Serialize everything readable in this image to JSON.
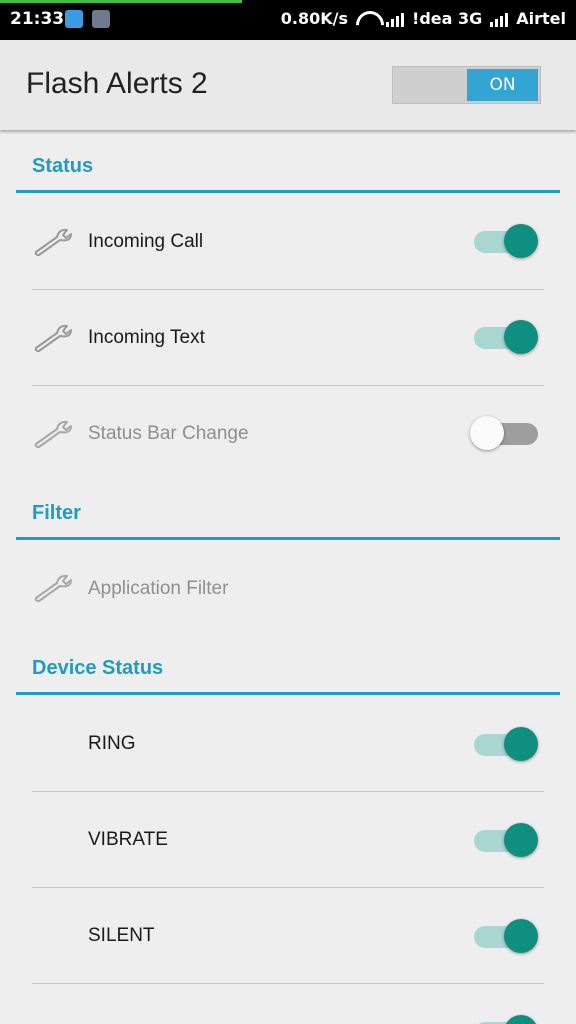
{
  "status_bar": {
    "time": "21:33",
    "net_speed": "0.80K/s",
    "carrier1": "!dea 3G",
    "carrier2": "Airtel"
  },
  "app_bar": {
    "title": "Flash Alerts 2",
    "master_toggle_label": "ON"
  },
  "sections": {
    "status": {
      "header": "Status",
      "items": [
        {
          "label": "Incoming Call",
          "enabled": true,
          "checked": true
        },
        {
          "label": "Incoming Text",
          "enabled": true,
          "checked": true
        },
        {
          "label": "Status Bar Change",
          "enabled": false,
          "checked": false
        }
      ]
    },
    "filter": {
      "header": "Filter",
      "items": [
        {
          "label": "Application Filter",
          "enabled": false
        }
      ]
    },
    "device_status": {
      "header": "Device Status",
      "items": [
        {
          "label": "RING",
          "checked": true
        },
        {
          "label": "VIBRATE",
          "checked": true
        },
        {
          "label": "SILENT",
          "checked": true
        }
      ]
    }
  },
  "colors": {
    "accent": "#1e9cc2",
    "switch_on_thumb": "#0e8f80",
    "switch_on_track": "#a8d7d2",
    "toggle_on": "#33a5d3"
  }
}
